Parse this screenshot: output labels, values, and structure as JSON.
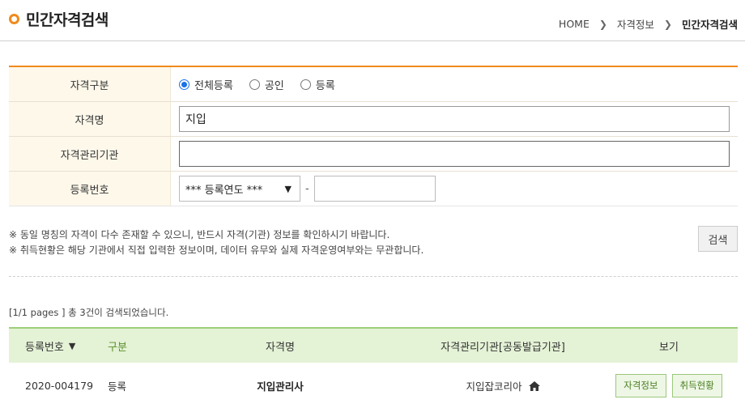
{
  "header": {
    "title": "민간자격검색",
    "breadcrumb": [
      "HOME",
      "자격정보",
      "민간자격검색"
    ]
  },
  "form": {
    "category_label": "자격구분",
    "category_options": [
      "전체등록",
      "공인",
      "등록"
    ],
    "category_selected": "전체등록",
    "name_label": "자격명",
    "name_value": "지입",
    "agency_label": "자격관리기관",
    "agency_value": "",
    "regno_label": "등록번호",
    "regno_year_select": "*** 등록연도 ***",
    "regno_dash": "-",
    "regno_value": ""
  },
  "notices": [
    "※ 동일 명칭의 자격이 다수 존재할 수 있으니, 반드시 자격(기관) 정보를 확인하시기 바랍니다.",
    "※ 취득현황은 해당 기관에서 직접 입력한 정보이며, 데이터 유무와 실제 자격운영여부와는 무관합니다."
  ],
  "search_button": "검색",
  "result_count": "[1/1 pages ] 총 3건이 검색되었습니다.",
  "table": {
    "headers": [
      "등록번호",
      "구분",
      "자격명",
      "자격관리기관[공동발급기관]",
      "보기"
    ],
    "rows": [
      {
        "regno": "2020-004179",
        "category": "등록",
        "name": "지입관리사",
        "agency": "지입잡코리아",
        "btn_info": "자격정보",
        "btn_status": "취득현황"
      }
    ]
  },
  "colors": {
    "accent_orange": "#f08a1c",
    "table_header_green": "#e4f2d6",
    "radio_blue": "#1a73e8"
  }
}
